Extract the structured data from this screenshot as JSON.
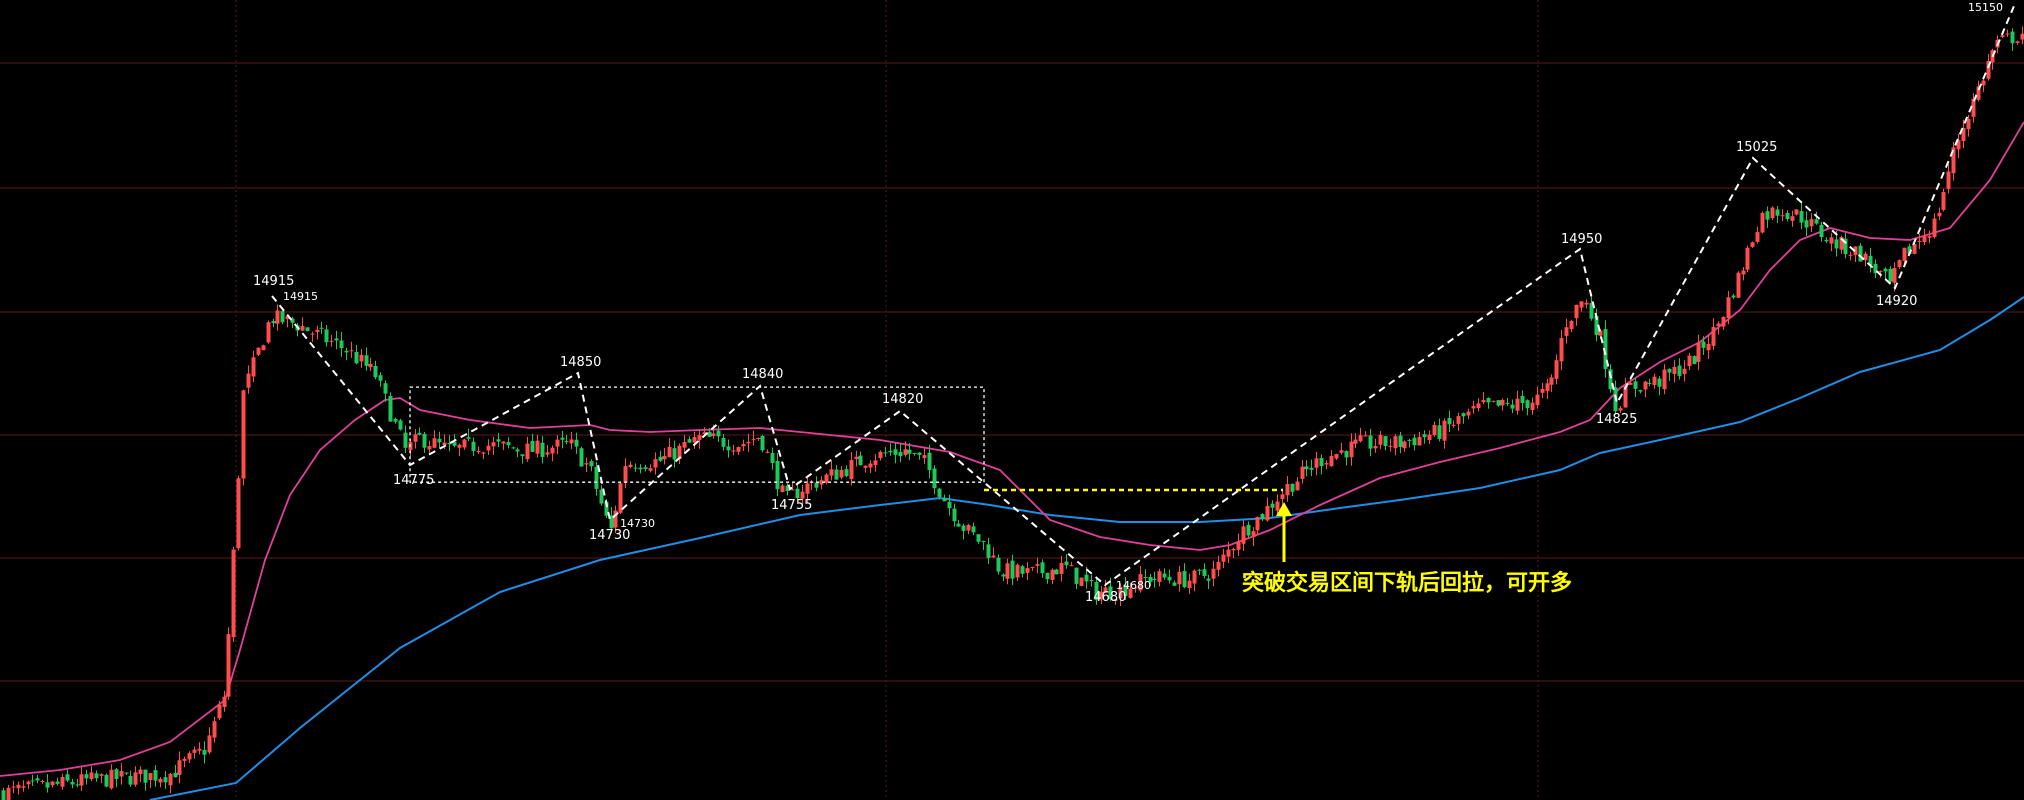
{
  "colors": {
    "background": "#000000",
    "grid": "#5a1a1a",
    "up": "#ff4d4d",
    "down": "#1ec85a",
    "ma_short": "#e0409a",
    "ma_long": "#1e8fe6",
    "zigzag": "#ffffff",
    "annotation": "#ffff00"
  },
  "chart_data": {
    "type": "candlestick",
    "y_range": [
      14530,
      15150
    ],
    "grid": true,
    "price_labels": [
      {
        "id": "l14915",
        "value": 14915,
        "text": "14915"
      },
      {
        "id": "l14915b",
        "value": 14915,
        "text": "14915"
      },
      {
        "id": "l14775",
        "value": 14775,
        "text": "14775"
      },
      {
        "id": "l14850",
        "value": 14850,
        "text": "14850"
      },
      {
        "id": "l14730",
        "value": 14730,
        "text": "14730"
      },
      {
        "id": "l14730b",
        "value": 14730,
        "text": "14730"
      },
      {
        "id": "l14840",
        "value": 14840,
        "text": "14840"
      },
      {
        "id": "l14755",
        "value": 14755,
        "text": "14755"
      },
      {
        "id": "l14820",
        "value": 14820,
        "text": "14820"
      },
      {
        "id": "l14680",
        "value": 14680,
        "text": "14680"
      },
      {
        "id": "l14680b",
        "value": 14680,
        "text": "14680"
      },
      {
        "id": "l14950",
        "value": 14950,
        "text": "14950"
      },
      {
        "id": "l14825",
        "value": 14825,
        "text": "14825"
      },
      {
        "id": "l15025",
        "value": 15025,
        "text": "15025"
      },
      {
        "id": "l14920",
        "value": 14920,
        "text": "14920"
      },
      {
        "id": "l15150",
        "value": 15150,
        "text": "15150"
      }
    ],
    "zigzag_pivots": [
      14915,
      14775,
      14850,
      14730,
      14840,
      14755,
      14820,
      14680,
      14950,
      14825,
      15025,
      14920,
      15150
    ],
    "range_box": {
      "top": 14850,
      "bottom": 14775
    },
    "breakout_level": 14775,
    "annotation": "突破交易区间下轨后回拉，可开多",
    "series": [
      {
        "key": "ma_short"
      },
      {
        "key": "ma_long"
      }
    ]
  }
}
